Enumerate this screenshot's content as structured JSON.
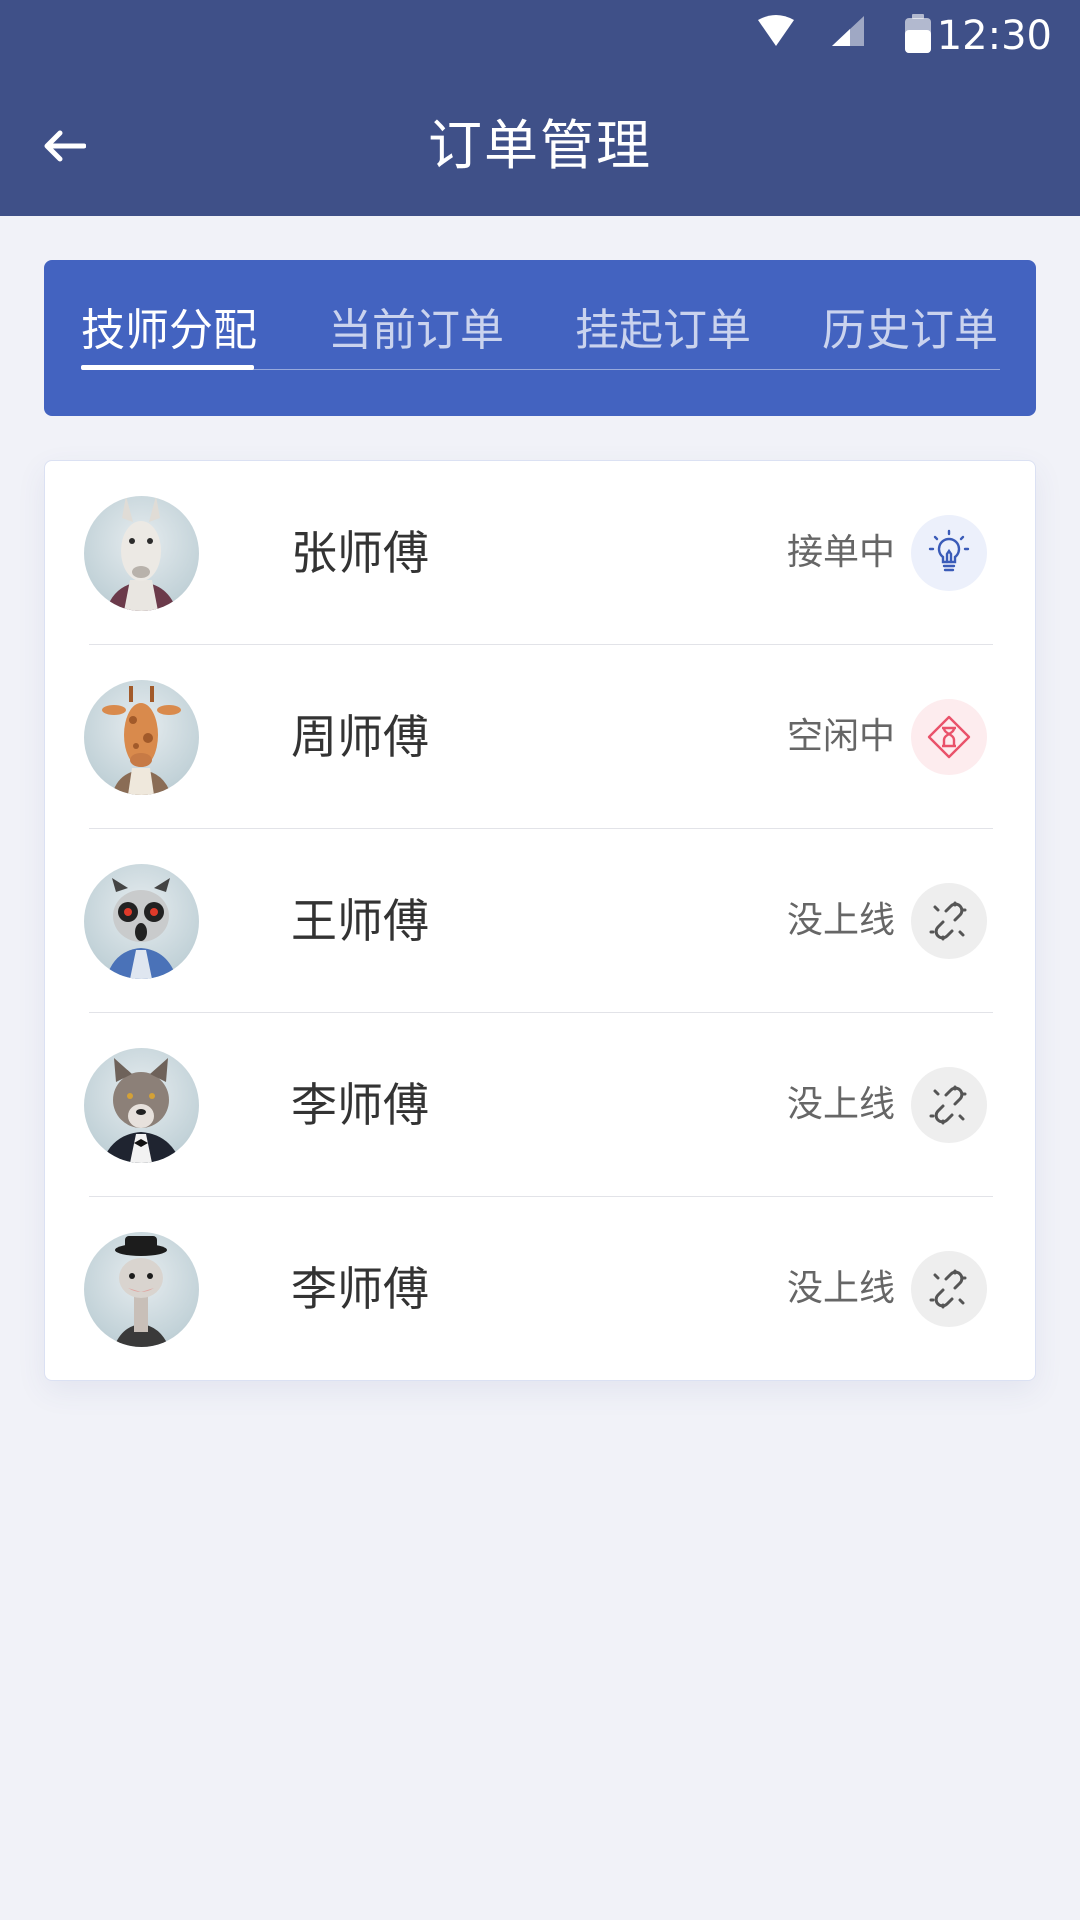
{
  "status_bar": {
    "time": "12:30"
  },
  "header": {
    "title": "订单管理"
  },
  "tabs": [
    {
      "label": "技师分配",
      "active": true
    },
    {
      "label": "当前订单",
      "active": false
    },
    {
      "label": "挂起订单",
      "active": false
    },
    {
      "label": "历史订单",
      "active": false
    }
  ],
  "technicians": [
    {
      "name": "张师傅",
      "status": "接单中",
      "status_icon": "lightbulb-icon",
      "avatar": "llama-avatar"
    },
    {
      "name": "周师傅",
      "status": "空闲中",
      "status_icon": "hourglass-icon",
      "avatar": "giraffe-avatar"
    },
    {
      "name": "王师傅",
      "status": "没上线",
      "status_icon": "broken-link-icon",
      "avatar": "lemur-avatar"
    },
    {
      "name": "李师傅",
      "status": "没上线",
      "status_icon": "broken-link-icon",
      "avatar": "wolf-avatar"
    },
    {
      "name": "李师傅",
      "status": "没上线",
      "status_icon": "broken-link-icon",
      "avatar": "ostrich-avatar"
    }
  ],
  "colors": {
    "header": "#3f5088",
    "tab_panel": "#4363c0",
    "background": "#f1f2f8",
    "busy_icon": "#3a5bb8",
    "idle_icon": "#e9526a",
    "offline_icon": "#555555"
  }
}
